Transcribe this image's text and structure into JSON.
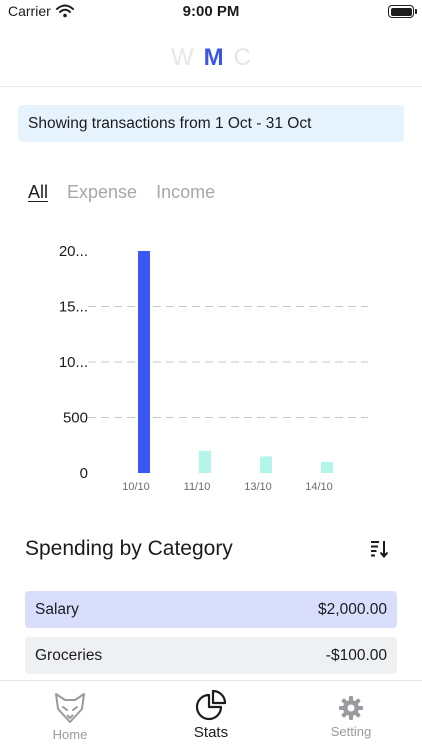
{
  "status_bar": {
    "carrier": "Carrier",
    "time": "9:00 PM"
  },
  "period_switch": {
    "options": [
      {
        "label": "W",
        "active": false
      },
      {
        "label": "M",
        "active": true
      },
      {
        "label": "C",
        "active": false
      }
    ]
  },
  "range_banner": {
    "text": "Showing transactions from 1 Oct - 31 Oct"
  },
  "filter_tabs": [
    {
      "label": "All",
      "active": true
    },
    {
      "label": "Expense",
      "active": false
    },
    {
      "label": "Income",
      "active": false
    }
  ],
  "chart_data": {
    "type": "bar",
    "categories": [
      "10/10",
      "11/10",
      "13/10",
      "14/10"
    ],
    "values": [
      2000,
      200,
      150,
      100
    ],
    "colors": [
      "#3a56f4",
      "#b3f5e8",
      "#b3f5e8",
      "#b3f5e8"
    ],
    "yticks": [
      0,
      500,
      1000,
      1500,
      2000
    ],
    "ytick_labels": [
      "0",
      "500",
      "10...",
      "15...",
      "20..."
    ],
    "ylim": [
      0,
      2000
    ],
    "grid": true,
    "title": "",
    "xlabel": "",
    "ylabel": ""
  },
  "spending": {
    "title": "Spending by Category",
    "sort_icon": "sort-descending-icon",
    "items": [
      {
        "name": "Salary",
        "amount": "$2,000.00"
      },
      {
        "name": "Groceries",
        "amount": "-$100.00"
      }
    ]
  },
  "tab_bar": {
    "items": [
      {
        "label": "Home",
        "icon": "fox-icon",
        "active": false
      },
      {
        "label": "Stats",
        "icon": "pie-chart-icon",
        "active": true
      },
      {
        "label": "Setting",
        "icon": "gear-icon",
        "active": false
      }
    ]
  },
  "colors": {
    "accent": "#3a56e4",
    "banner_bg": "#e6f3fd",
    "row_highlight": "#d9defd",
    "row_plain": "#eef0f2",
    "bar_primary": "#3a56f4",
    "bar_secondary": "#b3f5e8"
  }
}
